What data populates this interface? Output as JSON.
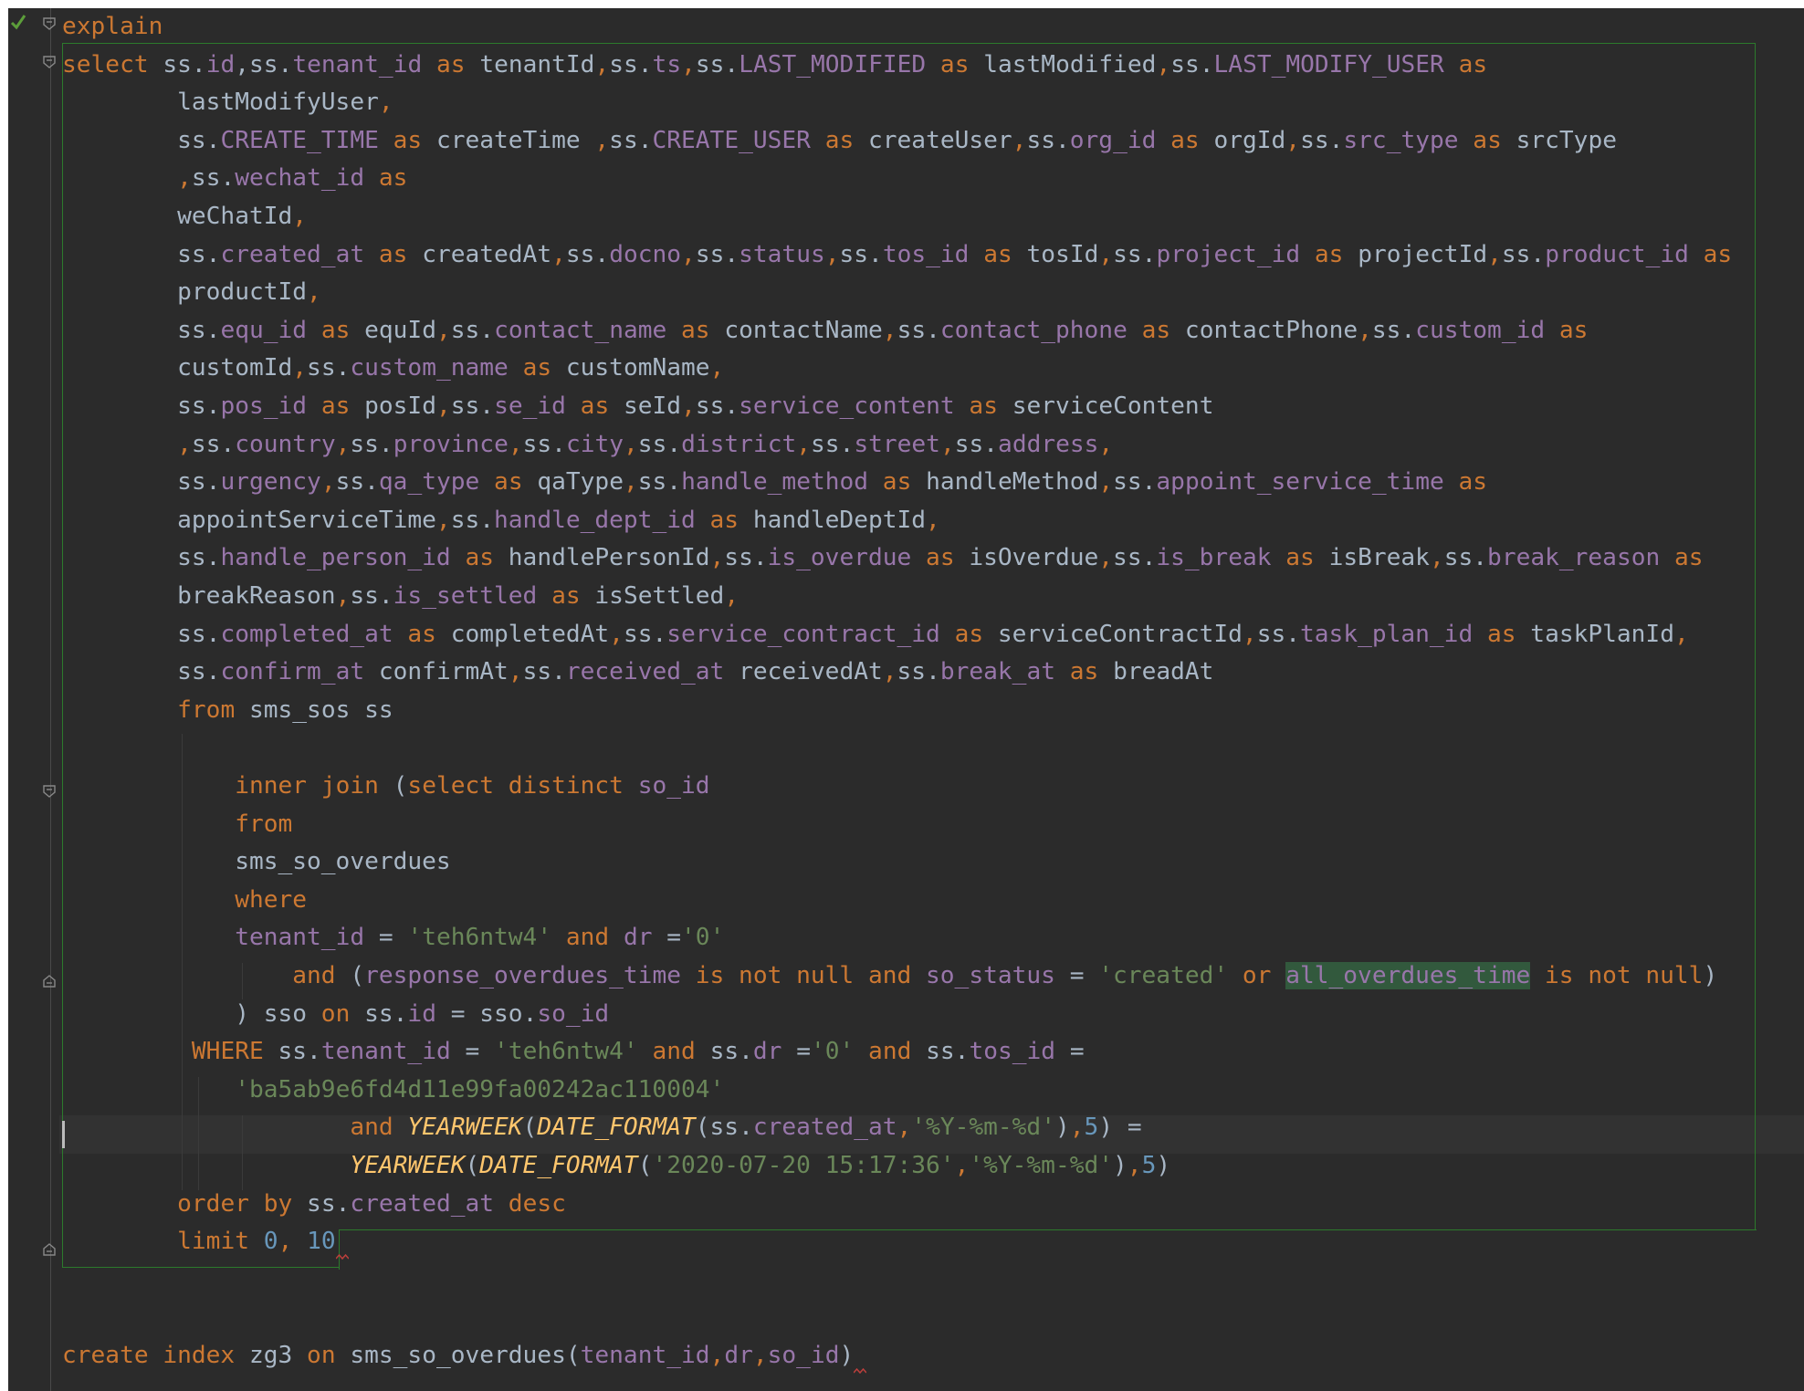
{
  "colors": {
    "background": "#2b2b2b",
    "keyword": "#cc7832",
    "identifier": "#a9b7c6",
    "column": "#9876aa",
    "string": "#6a8759",
    "number": "#6897bb",
    "function": "#ffc66d",
    "selection_box": "#2c7a2c",
    "highlight": "#32593d"
  },
  "icons": {
    "gutter_check": "check-icon",
    "fold_markers": "fold-marker-icon",
    "error_marker": "squiggle-error-icon"
  },
  "lines": [
    [
      {
        "t": "explain",
        "c": "kw"
      }
    ],
    [
      {
        "t": "select ",
        "c": "kw"
      },
      {
        "t": "ss."
      },
      {
        "t": "id",
        "c": "col"
      },
      {
        "t": ","
      },
      {
        "t": "ss."
      },
      {
        "t": "tenant_id",
        "c": "col"
      },
      {
        "t": " as ",
        "c": "kw"
      },
      {
        "t": "tenantId"
      },
      {
        "t": ",",
        "c": "kw"
      },
      {
        "t": "ss."
      },
      {
        "t": "ts",
        "c": "col"
      },
      {
        "t": ",",
        "c": "kw"
      },
      {
        "t": "ss."
      },
      {
        "t": "LAST_MODIFIED",
        "c": "col"
      },
      {
        "t": " as ",
        "c": "kw"
      },
      {
        "t": "lastModified"
      },
      {
        "t": ",",
        "c": "kw"
      },
      {
        "t": "ss."
      },
      {
        "t": "LAST_MODIFY_USER",
        "c": "col"
      },
      {
        "t": " as",
        "c": "kw"
      }
    ],
    [
      {
        "t": "        lastModifyUser"
      },
      {
        "t": ",",
        "c": "kw"
      }
    ],
    [
      {
        "t": "        ss."
      },
      {
        "t": "CREATE_TIME",
        "c": "col"
      },
      {
        "t": " as ",
        "c": "kw"
      },
      {
        "t": "createTime "
      },
      {
        "t": ",",
        "c": "kw"
      },
      {
        "t": "ss."
      },
      {
        "t": "CREATE_USER",
        "c": "col"
      },
      {
        "t": " as ",
        "c": "kw"
      },
      {
        "t": "createUser"
      },
      {
        "t": ",",
        "c": "kw"
      },
      {
        "t": "ss."
      },
      {
        "t": "org_id",
        "c": "col"
      },
      {
        "t": " as ",
        "c": "kw"
      },
      {
        "t": "orgId"
      },
      {
        "t": ",",
        "c": "kw"
      },
      {
        "t": "ss."
      },
      {
        "t": "src_type",
        "c": "col"
      },
      {
        "t": " as ",
        "c": "kw"
      },
      {
        "t": "srcType"
      }
    ],
    [
      {
        "t": "        "
      },
      {
        "t": ",",
        "c": "kw"
      },
      {
        "t": "ss."
      },
      {
        "t": "wechat_id",
        "c": "col"
      },
      {
        "t": " as",
        "c": "kw"
      }
    ],
    [
      {
        "t": "        weChatId"
      },
      {
        "t": ",",
        "c": "kw"
      }
    ],
    [
      {
        "t": "        ss."
      },
      {
        "t": "created_at",
        "c": "col"
      },
      {
        "t": " as ",
        "c": "kw"
      },
      {
        "t": "createdAt"
      },
      {
        "t": ",",
        "c": "kw"
      },
      {
        "t": "ss."
      },
      {
        "t": "docno",
        "c": "col"
      },
      {
        "t": ",",
        "c": "kw"
      },
      {
        "t": "ss."
      },
      {
        "t": "status",
        "c": "col"
      },
      {
        "t": ",",
        "c": "kw"
      },
      {
        "t": "ss."
      },
      {
        "t": "tos_id",
        "c": "col"
      },
      {
        "t": " as ",
        "c": "kw"
      },
      {
        "t": "tosId"
      },
      {
        "t": ",",
        "c": "kw"
      },
      {
        "t": "ss."
      },
      {
        "t": "project_id",
        "c": "col"
      },
      {
        "t": " as ",
        "c": "kw"
      },
      {
        "t": "projectId"
      },
      {
        "t": ",",
        "c": "kw"
      },
      {
        "t": "ss."
      },
      {
        "t": "product_id",
        "c": "col"
      },
      {
        "t": " as",
        "c": "kw"
      }
    ],
    [
      {
        "t": "        productId"
      },
      {
        "t": ",",
        "c": "kw"
      }
    ],
    [
      {
        "t": "        ss."
      },
      {
        "t": "equ_id",
        "c": "col"
      },
      {
        "t": " as ",
        "c": "kw"
      },
      {
        "t": "equId"
      },
      {
        "t": ",",
        "c": "kw"
      },
      {
        "t": "ss."
      },
      {
        "t": "contact_name",
        "c": "col"
      },
      {
        "t": " as ",
        "c": "kw"
      },
      {
        "t": "contactName"
      },
      {
        "t": ",",
        "c": "kw"
      },
      {
        "t": "ss."
      },
      {
        "t": "contact_phone",
        "c": "col"
      },
      {
        "t": " as ",
        "c": "kw"
      },
      {
        "t": "contactPhone"
      },
      {
        "t": ",",
        "c": "kw"
      },
      {
        "t": "ss."
      },
      {
        "t": "custom_id",
        "c": "col"
      },
      {
        "t": " as",
        "c": "kw"
      }
    ],
    [
      {
        "t": "        customId"
      },
      {
        "t": ",",
        "c": "kw"
      },
      {
        "t": "ss."
      },
      {
        "t": "custom_name",
        "c": "col"
      },
      {
        "t": " as ",
        "c": "kw"
      },
      {
        "t": "customName"
      },
      {
        "t": ",",
        "c": "kw"
      }
    ],
    [
      {
        "t": "        ss."
      },
      {
        "t": "pos_id",
        "c": "col"
      },
      {
        "t": " as ",
        "c": "kw"
      },
      {
        "t": "posId"
      },
      {
        "t": ",",
        "c": "kw"
      },
      {
        "t": "ss."
      },
      {
        "t": "se_id",
        "c": "col"
      },
      {
        "t": " as ",
        "c": "kw"
      },
      {
        "t": "seId"
      },
      {
        "t": ",",
        "c": "kw"
      },
      {
        "t": "ss."
      },
      {
        "t": "service_content",
        "c": "col"
      },
      {
        "t": " as ",
        "c": "kw"
      },
      {
        "t": "serviceContent"
      }
    ],
    [
      {
        "t": "        "
      },
      {
        "t": ",",
        "c": "kw"
      },
      {
        "t": "ss."
      },
      {
        "t": "country",
        "c": "col"
      },
      {
        "t": ",",
        "c": "kw"
      },
      {
        "t": "ss."
      },
      {
        "t": "province",
        "c": "col"
      },
      {
        "t": ",",
        "c": "kw"
      },
      {
        "t": "ss."
      },
      {
        "t": "city",
        "c": "col"
      },
      {
        "t": ",",
        "c": "kw"
      },
      {
        "t": "ss."
      },
      {
        "t": "district",
        "c": "col"
      },
      {
        "t": ",",
        "c": "kw"
      },
      {
        "t": "ss."
      },
      {
        "t": "street",
        "c": "col"
      },
      {
        "t": ",",
        "c": "kw"
      },
      {
        "t": "ss."
      },
      {
        "t": "address",
        "c": "col"
      },
      {
        "t": ",",
        "c": "kw"
      }
    ],
    [
      {
        "t": "        ss."
      },
      {
        "t": "urgency",
        "c": "col"
      },
      {
        "t": ",",
        "c": "kw"
      },
      {
        "t": "ss."
      },
      {
        "t": "qa_type",
        "c": "col"
      },
      {
        "t": " as ",
        "c": "kw"
      },
      {
        "t": "qaType"
      },
      {
        "t": ",",
        "c": "kw"
      },
      {
        "t": "ss."
      },
      {
        "t": "handle_method",
        "c": "col"
      },
      {
        "t": " as ",
        "c": "kw"
      },
      {
        "t": "handleMethod"
      },
      {
        "t": ",",
        "c": "kw"
      },
      {
        "t": "ss."
      },
      {
        "t": "appoint_service_time",
        "c": "col"
      },
      {
        "t": " as",
        "c": "kw"
      }
    ],
    [
      {
        "t": "        appointServiceTime"
      },
      {
        "t": ",",
        "c": "kw"
      },
      {
        "t": "ss."
      },
      {
        "t": "handle_dept_id",
        "c": "col"
      },
      {
        "t": " as ",
        "c": "kw"
      },
      {
        "t": "handleDeptId"
      },
      {
        "t": ",",
        "c": "kw"
      }
    ],
    [
      {
        "t": "        ss."
      },
      {
        "t": "handle_person_id",
        "c": "col"
      },
      {
        "t": " as ",
        "c": "kw"
      },
      {
        "t": "handlePersonId"
      },
      {
        "t": ",",
        "c": "kw"
      },
      {
        "t": "ss."
      },
      {
        "t": "is_overdue",
        "c": "col"
      },
      {
        "t": " as ",
        "c": "kw"
      },
      {
        "t": "isOverdue"
      },
      {
        "t": ",",
        "c": "kw"
      },
      {
        "t": "ss."
      },
      {
        "t": "is_break",
        "c": "col"
      },
      {
        "t": " as ",
        "c": "kw"
      },
      {
        "t": "isBreak"
      },
      {
        "t": ",",
        "c": "kw"
      },
      {
        "t": "ss."
      },
      {
        "t": "break_reason",
        "c": "col"
      },
      {
        "t": " as",
        "c": "kw"
      }
    ],
    [
      {
        "t": "        breakReason"
      },
      {
        "t": ",",
        "c": "kw"
      },
      {
        "t": "ss."
      },
      {
        "t": "is_settled",
        "c": "col"
      },
      {
        "t": " as ",
        "c": "kw"
      },
      {
        "t": "isSettled"
      },
      {
        "t": ",",
        "c": "kw"
      }
    ],
    [
      {
        "t": "        ss."
      },
      {
        "t": "completed_at",
        "c": "col"
      },
      {
        "t": " as ",
        "c": "kw"
      },
      {
        "t": "completedAt"
      },
      {
        "t": ",",
        "c": "kw"
      },
      {
        "t": "ss."
      },
      {
        "t": "service_contract_id",
        "c": "col"
      },
      {
        "t": " as ",
        "c": "kw"
      },
      {
        "t": "serviceContractId"
      },
      {
        "t": ",",
        "c": "kw"
      },
      {
        "t": "ss."
      },
      {
        "t": "task_plan_id",
        "c": "col"
      },
      {
        "t": " as ",
        "c": "kw"
      },
      {
        "t": "taskPlanId"
      },
      {
        "t": ",",
        "c": "kw"
      }
    ],
    [
      {
        "t": "        ss."
      },
      {
        "t": "confirm_at",
        "c": "col"
      },
      {
        "t": " confirmAt"
      },
      {
        "t": ",",
        "c": "kw"
      },
      {
        "t": "ss."
      },
      {
        "t": "received_at",
        "c": "col"
      },
      {
        "t": " receivedAt"
      },
      {
        "t": ",",
        "c": "kw"
      },
      {
        "t": "ss."
      },
      {
        "t": "break_at",
        "c": "col"
      },
      {
        "t": " as ",
        "c": "kw"
      },
      {
        "t": "breadAt"
      }
    ],
    [
      {
        "t": "        "
      },
      {
        "t": "from ",
        "c": "kw"
      },
      {
        "t": "sms_sos ss"
      }
    ],
    [],
    [
      {
        "t": "            "
      },
      {
        "t": "inner join ",
        "c": "kw"
      },
      {
        "t": "("
      },
      {
        "t": "select distinct ",
        "c": "kw"
      },
      {
        "t": "so_id",
        "c": "col"
      }
    ],
    [
      {
        "t": "            "
      },
      {
        "t": "from",
        "c": "kw"
      }
    ],
    [
      {
        "t": "            sms_so_overdues"
      }
    ],
    [
      {
        "t": "            "
      },
      {
        "t": "where",
        "c": "kw"
      }
    ],
    [
      {
        "t": "            "
      },
      {
        "t": "tenant_id",
        "c": "col"
      },
      {
        "t": " = "
      },
      {
        "t": "'teh6ntw4'",
        "c": "str"
      },
      {
        "t": " and ",
        "c": "kw"
      },
      {
        "t": "dr",
        "c": "col"
      },
      {
        "t": " ="
      },
      {
        "t": "'0'",
        "c": "str"
      }
    ],
    [
      {
        "t": "                "
      },
      {
        "t": "and ",
        "c": "kw"
      },
      {
        "t": "("
      },
      {
        "t": "response_overdues_time",
        "c": "col"
      },
      {
        "t": " is not null and ",
        "c": "kw"
      },
      {
        "t": "so_status",
        "c": "col"
      },
      {
        "t": " = "
      },
      {
        "t": "'created'",
        "c": "str"
      },
      {
        "t": " or ",
        "c": "kw"
      },
      {
        "t": "all_overdues_time",
        "c": "hl"
      },
      {
        "t": " is not null",
        "c": "kw"
      },
      {
        "t": ")"
      }
    ],
    [
      {
        "t": "            ) sso "
      },
      {
        "t": "on ",
        "c": "kw"
      },
      {
        "t": "ss."
      },
      {
        "t": "id",
        "c": "col"
      },
      {
        "t": " = sso."
      },
      {
        "t": "so_id",
        "c": "col"
      }
    ],
    [
      {
        "t": "         "
      },
      {
        "t": "WHERE ",
        "c": "kw"
      },
      {
        "t": "ss."
      },
      {
        "t": "tenant_id",
        "c": "col"
      },
      {
        "t": " = "
      },
      {
        "t": "'teh6ntw4'",
        "c": "str"
      },
      {
        "t": " and ",
        "c": "kw"
      },
      {
        "t": "ss."
      },
      {
        "t": "dr",
        "c": "col"
      },
      {
        "t": " ="
      },
      {
        "t": "'0'",
        "c": "str"
      },
      {
        "t": " and ",
        "c": "kw"
      },
      {
        "t": "ss."
      },
      {
        "t": "tos_id",
        "c": "col"
      },
      {
        "t": " ="
      }
    ],
    [
      {
        "t": "            "
      },
      {
        "t": "'ba5ab9e6fd4d11e99fa00242ac110004'",
        "c": "str"
      }
    ],
    [
      {
        "t": "                    "
      },
      {
        "t": "and ",
        "c": "kw"
      },
      {
        "t": "YEARWEEK",
        "c": "fn"
      },
      {
        "t": "("
      },
      {
        "t": "DATE_FORMAT",
        "c": "fn"
      },
      {
        "t": "(ss."
      },
      {
        "t": "created_at",
        "c": "col"
      },
      {
        "t": ",",
        "c": "kw"
      },
      {
        "t": "'%Y-%m-%d'",
        "c": "str"
      },
      {
        "t": ")"
      },
      {
        "t": ",",
        "c": "kw"
      },
      {
        "t": "5",
        "c": "num"
      },
      {
        "t": ") ="
      }
    ],
    [
      {
        "t": "                    "
      },
      {
        "t": "YEARWEEK",
        "c": "fn"
      },
      {
        "t": "("
      },
      {
        "t": "DATE_FORMAT",
        "c": "fn"
      },
      {
        "t": "("
      },
      {
        "t": "'2020-07-20 15:17:36'",
        "c": "str"
      },
      {
        "t": ",",
        "c": "kw"
      },
      {
        "t": "'%Y-%m-%d'",
        "c": "str"
      },
      {
        "t": ")"
      },
      {
        "t": ",",
        "c": "kw"
      },
      {
        "t": "5",
        "c": "num"
      },
      {
        "t": ")"
      }
    ],
    [
      {
        "t": "        "
      },
      {
        "t": "order by ",
        "c": "kw"
      },
      {
        "t": "ss."
      },
      {
        "t": "created_at",
        "c": "col"
      },
      {
        "t": " desc",
        "c": "kw"
      }
    ],
    [
      {
        "t": "        "
      },
      {
        "t": "limit ",
        "c": "kw"
      },
      {
        "t": "0",
        "c": "num"
      },
      {
        "t": ", ",
        "c": "kw"
      },
      {
        "t": "10",
        "c": "num"
      },
      {
        "t": "",
        "c": "squiggle"
      }
    ],
    [],
    [],
    [
      {
        "t": "create index ",
        "c": "kw"
      },
      {
        "t": "zg3 "
      },
      {
        "t": "on ",
        "c": "kw"
      },
      {
        "t": "sms_so_overdues("
      },
      {
        "t": "tenant_id",
        "c": "col"
      },
      {
        "t": ",",
        "c": "kw"
      },
      {
        "t": "dr",
        "c": "col"
      },
      {
        "t": ",",
        "c": "kw"
      },
      {
        "t": "so_id",
        "c": "col"
      },
      {
        "t": ")"
      },
      {
        "t": "",
        "c": "squiggle"
      }
    ]
  ]
}
